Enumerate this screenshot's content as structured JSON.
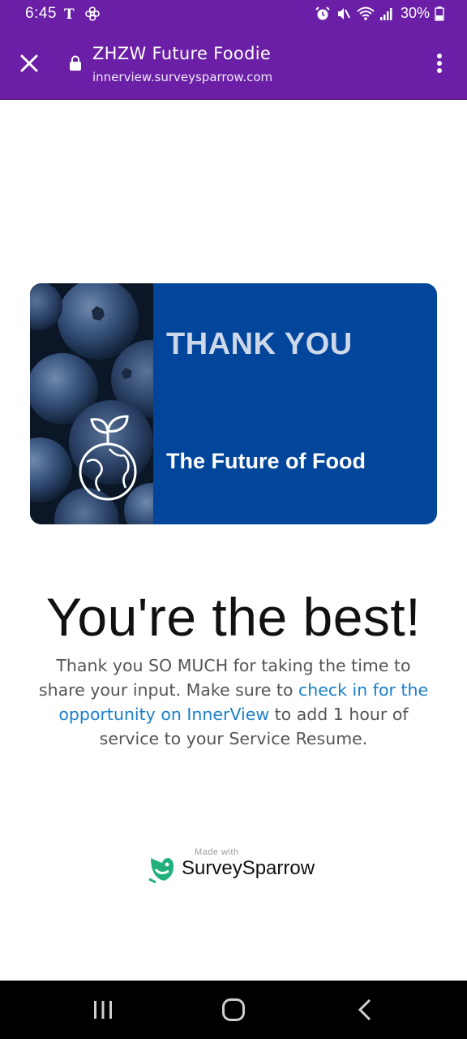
{
  "status_bar": {
    "time": "6:45",
    "battery": "30%",
    "left_icons": [
      "nyt-icon",
      "pinwheel-icon"
    ],
    "right_icons": [
      "alarm-icon",
      "mute-icon",
      "wifi-icon",
      "signal-icon",
      "battery-icon"
    ]
  },
  "toolbar": {
    "title": "ZHZW Future Foodie",
    "url": "innerview.surveysparrow.com",
    "close_icon": "close-icon",
    "lock_icon": "lock-icon",
    "menu_icon": "more-vert-icon"
  },
  "banner": {
    "heading": "THANK YOU",
    "subheading": "The Future of Food",
    "icon": "globe-sprout-icon"
  },
  "message": {
    "headline": "You're the best!",
    "text_before": "Thank you SO MUCH for taking the time to share your input. Make sure to ",
    "link_text": "check in for the opportunity on InnerView",
    "text_after": " to add 1 hour of service to your Service Resume."
  },
  "footer": {
    "made_with": "Made with",
    "brand": "SurveySparrow"
  },
  "colors": {
    "purple": "#6a1fa6",
    "banner_blue": "#02469c",
    "link_blue": "#1a7fc8",
    "brand_green": "#22b07d"
  }
}
